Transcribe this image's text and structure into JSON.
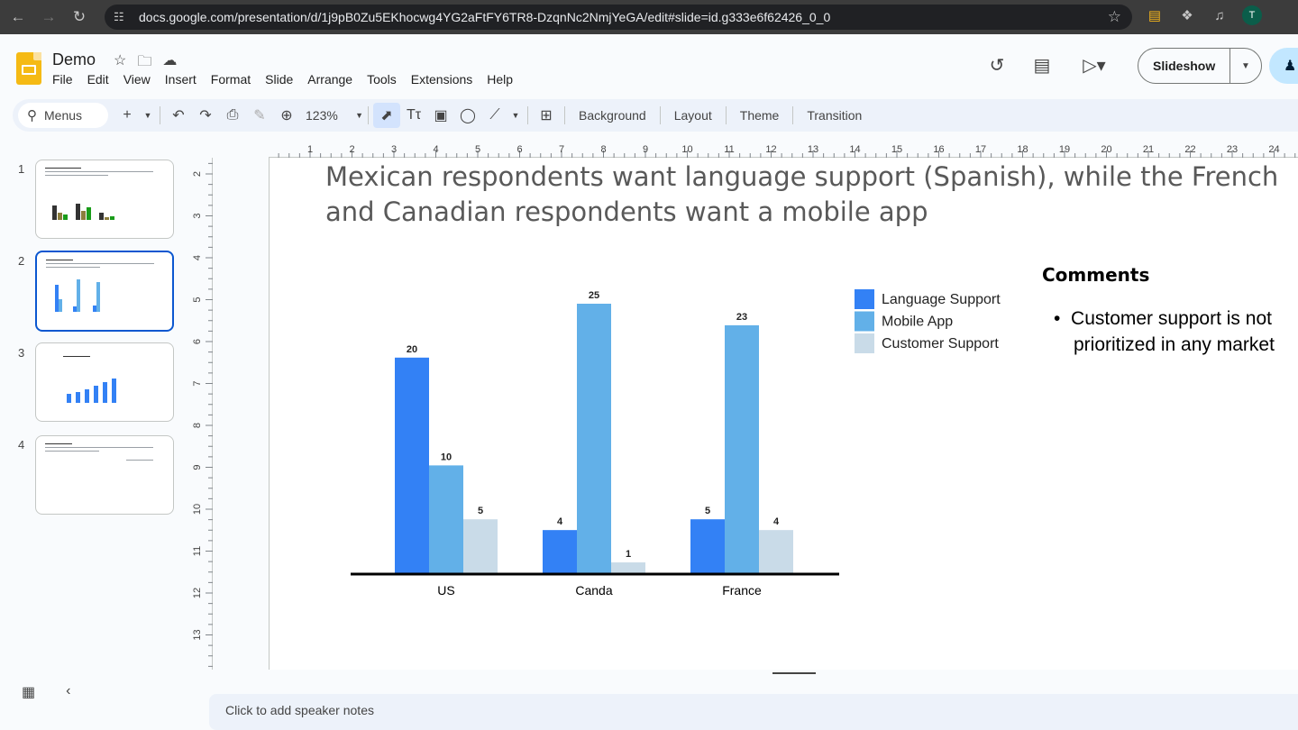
{
  "browser": {
    "url": "docs.google.com/presentation/d/1j9pB0Zu5EKhocwg4YG2aFtFY6TR8-DzqnNc2NmjYeGA/edit#slide=id.g333e6f62426_0_0",
    "profile_initial": "T"
  },
  "app": {
    "title": "Demo",
    "menu": [
      "File",
      "Edit",
      "View",
      "Insert",
      "Format",
      "Slide",
      "Arrange",
      "Tools",
      "Extensions",
      "Help"
    ],
    "slideshow_label": "Slideshow"
  },
  "toolbar": {
    "menus_label": "Menus",
    "zoom": "123%",
    "background": "Background",
    "layout": "Layout",
    "theme": "Theme",
    "transition": "Transition"
  },
  "filmstrip": {
    "numbers": [
      "1",
      "2",
      "3",
      "4"
    ]
  },
  "rulers": {
    "h_ticks": [
      "1",
      "2",
      "3",
      "4",
      "5",
      "6",
      "7",
      "8",
      "9",
      "10",
      "11",
      "12",
      "13",
      "14",
      "15",
      "16",
      "17",
      "18",
      "19",
      "20",
      "21",
      "22",
      "23",
      "24"
    ],
    "v_ticks": [
      "2",
      "3",
      "4",
      "5",
      "6",
      "7",
      "8",
      "9",
      "10",
      "11",
      "12",
      "13"
    ]
  },
  "slide": {
    "title": "Mexican respondents want language support (Spanish), while the French and Canadian respondents want a mobile app",
    "comments_heading": "Comments",
    "bullet": "Customer support is not prioritized in any market"
  },
  "notes_placeholder": "Click to add speaker notes",
  "chart_data": {
    "type": "bar",
    "categories": [
      "US",
      "Canda",
      "France"
    ],
    "series": [
      {
        "name": "Language Support",
        "values": [
          20,
          4,
          5
        ],
        "color": "#3381f5"
      },
      {
        "name": "Mobile App",
        "values": [
          10,
          25,
          23
        ],
        "color": "#62b0e8"
      },
      {
        "name": "Customer Support",
        "values": [
          5,
          1,
          4
        ],
        "color": "#c9dbe8"
      }
    ],
    "title": "",
    "xlabel": "",
    "ylabel": "",
    "ylim": [
      0,
      25
    ],
    "grid": false,
    "legend": "right"
  }
}
